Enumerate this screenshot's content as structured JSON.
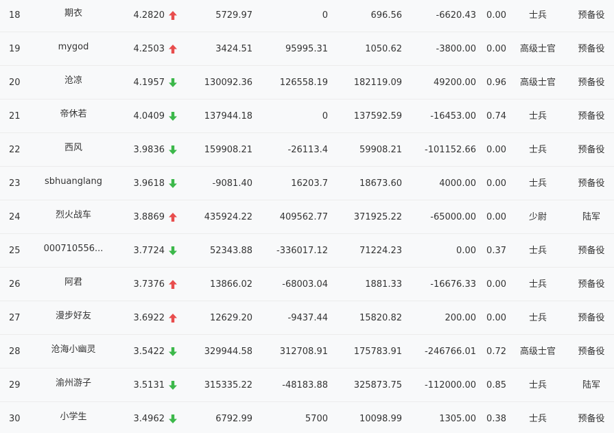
{
  "colors": {
    "up": "#e84d4d",
    "down": "#3cb84a"
  },
  "rows": [
    {
      "rank": "18",
      "name": "期衣",
      "score": "4.2820",
      "trend": "up",
      "v1": "5729.97",
      "v2": "0",
      "v3": "696.56",
      "v4": "-6620.43",
      "ratio": "0.00",
      "title": "士兵",
      "branch": "预备役"
    },
    {
      "rank": "19",
      "name": "mygod",
      "score": "4.2503",
      "trend": "up",
      "v1": "3424.51",
      "v2": "95995.31",
      "v3": "1050.62",
      "v4": "-3800.00",
      "ratio": "0.00",
      "title": "高级士官",
      "branch": "预备役"
    },
    {
      "rank": "20",
      "name": "沧凉",
      "score": "4.1957",
      "trend": "down",
      "v1": "130092.36",
      "v2": "126558.19",
      "v3": "182119.09",
      "v4": "49200.00",
      "ratio": "0.96",
      "title": "高级士官",
      "branch": "预备役"
    },
    {
      "rank": "21",
      "name": "帝休若",
      "score": "4.0409",
      "trend": "down",
      "v1": "137944.18",
      "v2": "0",
      "v3": "137592.59",
      "v4": "-16453.00",
      "ratio": "0.74",
      "title": "士兵",
      "branch": "预备役"
    },
    {
      "rank": "22",
      "name": "西风",
      "score": "3.9836",
      "trend": "down",
      "v1": "159908.21",
      "v2": "-26113.4",
      "v3": "59908.21",
      "v4": "-101152.66",
      "ratio": "0.00",
      "title": "士兵",
      "branch": "预备役"
    },
    {
      "rank": "23",
      "name": "sbhuanglang",
      "score": "3.9618",
      "trend": "down",
      "v1": "-9081.40",
      "v2": "16203.7",
      "v3": "18673.60",
      "v4": "4000.00",
      "ratio": "0.00",
      "title": "士兵",
      "branch": "预备役"
    },
    {
      "rank": "24",
      "name": "烈火战车",
      "score": "3.8869",
      "trend": "up",
      "v1": "435924.22",
      "v2": "409562.77",
      "v3": "371925.22",
      "v4": "-65000.00",
      "ratio": "0.00",
      "title": "少尉",
      "branch": "陆军"
    },
    {
      "rank": "25",
      "name": "000710556...",
      "score": "3.7724",
      "trend": "down",
      "v1": "52343.88",
      "v2": "-336017.12",
      "v3": "71224.23",
      "v4": "0.00",
      "ratio": "0.37",
      "title": "士兵",
      "branch": "预备役"
    },
    {
      "rank": "26",
      "name": "阿君",
      "score": "3.7376",
      "trend": "up",
      "v1": "13866.02",
      "v2": "-68003.04",
      "v3": "1881.33",
      "v4": "-16676.33",
      "ratio": "0.00",
      "title": "士兵",
      "branch": "预备役"
    },
    {
      "rank": "27",
      "name": "漫步好友",
      "score": "3.6922",
      "trend": "up",
      "v1": "12629.20",
      "v2": "-9437.44",
      "v3": "15820.82",
      "v4": "200.00",
      "ratio": "0.00",
      "title": "士兵",
      "branch": "预备役"
    },
    {
      "rank": "28",
      "name": "沧海小幽灵",
      "score": "3.5422",
      "trend": "down",
      "v1": "329944.58",
      "v2": "312708.91",
      "v3": "175783.91",
      "v4": "-246766.01",
      "ratio": "0.72",
      "title": "高级士官",
      "branch": "预备役"
    },
    {
      "rank": "29",
      "name": "渝州游子",
      "score": "3.5131",
      "trend": "down",
      "v1": "315335.22",
      "v2": "-48183.88",
      "v3": "325873.75",
      "v4": "-112000.00",
      "ratio": "0.85",
      "title": "士兵",
      "branch": "陆军"
    },
    {
      "rank": "30",
      "name": "小学生",
      "score": "3.4962",
      "trend": "down",
      "v1": "6792.99",
      "v2": "5700",
      "v3": "10098.99",
      "v4": "1305.00",
      "ratio": "0.38",
      "title": "士兵",
      "branch": "预备役"
    }
  ]
}
